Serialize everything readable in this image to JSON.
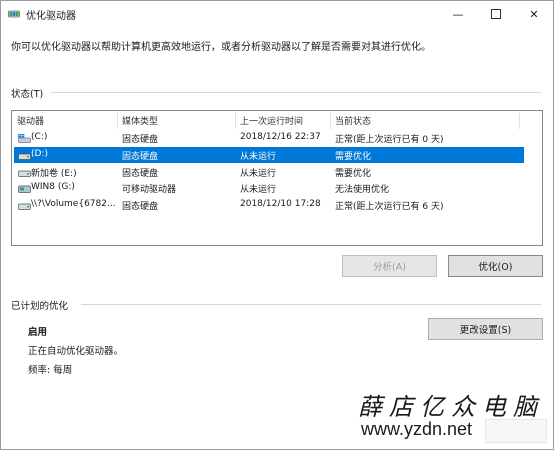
{
  "window": {
    "title": "优化驱动器",
    "icon": "defrag-app-icon"
  },
  "description": "你可以优化驱动器以帮助计算机更高效地运行，或者分析驱动器以了解是否需要对其进行优化。",
  "status": {
    "label": "状态(T)",
    "columns": [
      "驱动器",
      "媒体类型",
      "上一次运行时间",
      "当前状态"
    ],
    "rows": [
      {
        "drive": "(C:)",
        "media": "固态硬盘",
        "last_run": "2018/12/16 22:37",
        "status": "正常(距上次运行已有 0 天)",
        "icon": "windows-drive-icon",
        "selected": false
      },
      {
        "drive": "(D:)",
        "media": "固态硬盘",
        "last_run": "从未运行",
        "status": "需要优化",
        "icon": "drive-icon",
        "selected": true
      },
      {
        "drive": "新加卷 (E:)",
        "media": "固态硬盘",
        "last_run": "从未运行",
        "status": "需要优化",
        "icon": "drive-icon",
        "selected": false
      },
      {
        "drive": "WIN8 (G:)",
        "media": "可移动驱动器",
        "last_run": "从未运行",
        "status": "无法使用优化",
        "icon": "removable-drive-icon",
        "selected": false
      },
      {
        "drive": "\\\\?\\Volume{6782...",
        "media": "固态硬盘",
        "last_run": "2018/12/10 17:28",
        "status": "正常(距上次运行已有 6 天)",
        "icon": "drive-icon",
        "selected": false
      }
    ]
  },
  "buttons": {
    "analyze": "分析(A)",
    "optimize": "优化(O)",
    "change_settings": "更改设置(S)"
  },
  "scheduled": {
    "label": "已计划的优化",
    "state": "启用",
    "info": "正在自动优化驱动器。",
    "frequency": "频率: 每周"
  },
  "watermark": {
    "cn": "薛店亿众电脑",
    "url": "www.yzdn.net"
  },
  "colors": {
    "selection": "#0078d7",
    "accent_green": "#3aa63a"
  }
}
